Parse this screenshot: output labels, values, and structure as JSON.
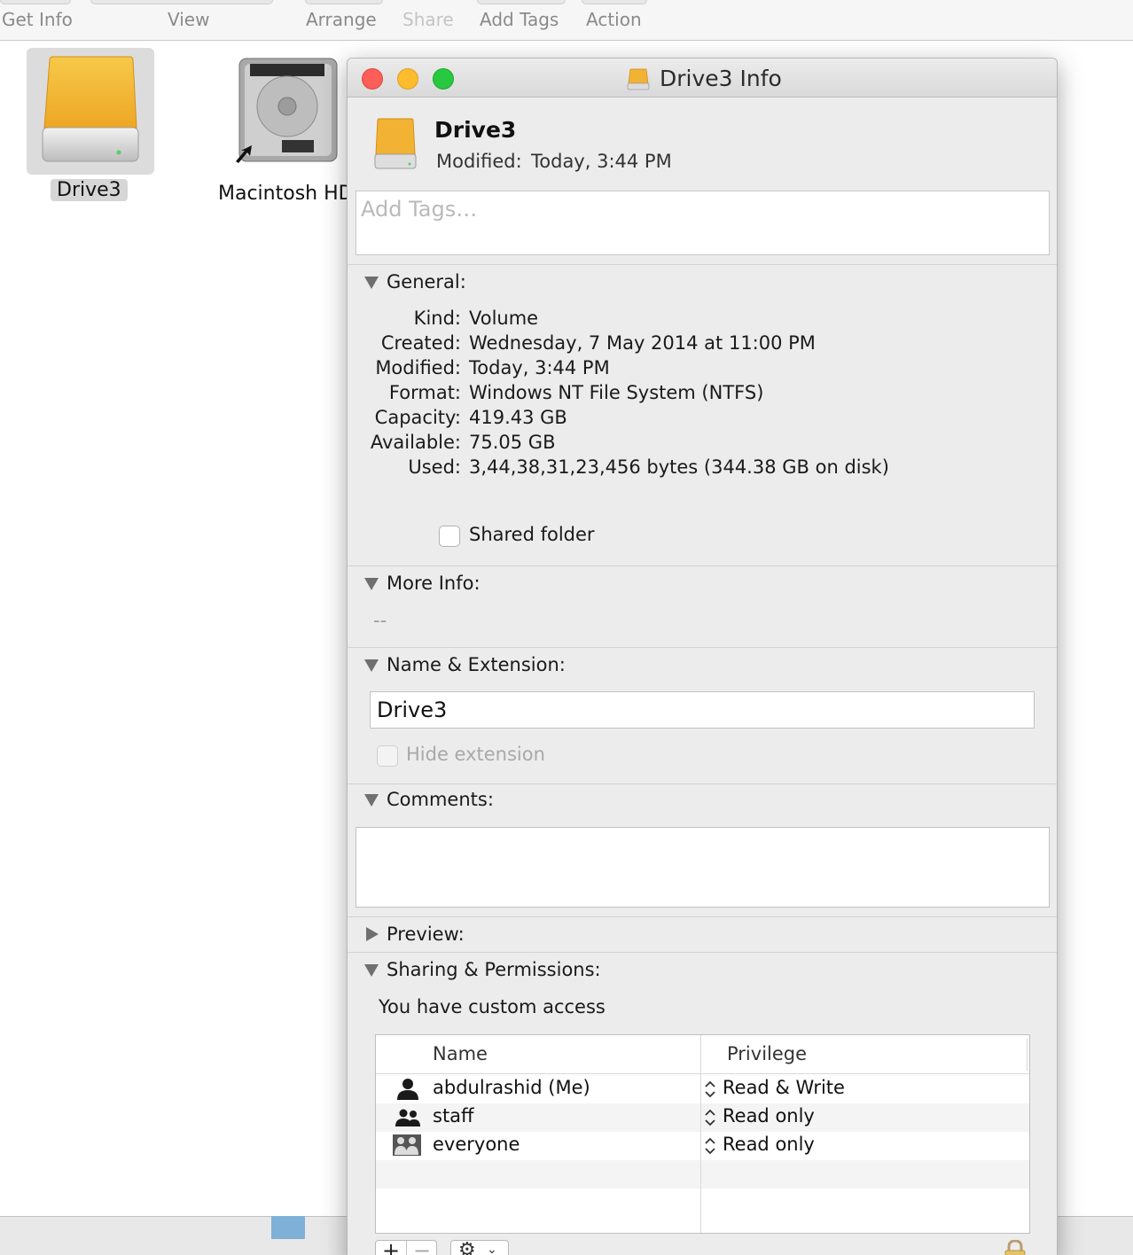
{
  "toolbar": {
    "items": [
      "Get Info",
      "View",
      "Arrange",
      "Share",
      "Add Tags",
      "Action"
    ]
  },
  "desktop": {
    "drive3_label": "Drive3",
    "macintosh_label": "Macintosh HD"
  },
  "window": {
    "title": "Drive3 Info",
    "name": "Drive3",
    "modified_label": "Modified:",
    "modified_value": "Today, 3:44 PM",
    "tags_placeholder": "Add Tags…"
  },
  "general": {
    "title": "General:",
    "rows": [
      {
        "key": "Kind:",
        "value": "Volume"
      },
      {
        "key": "Created:",
        "value": "Wednesday, 7 May 2014 at 11:00 PM"
      },
      {
        "key": "Modified:",
        "value": "Today, 3:44 PM"
      },
      {
        "key": "Format:",
        "value": "Windows NT File System (NTFS)"
      },
      {
        "key": "Capacity:",
        "value": "419.43 GB"
      },
      {
        "key": "Available:",
        "value": "75.05 GB"
      },
      {
        "key": "Used:",
        "value": "3,44,38,31,23,456 bytes (344.38 GB on disk)"
      }
    ],
    "shared_folder_label": "Shared folder"
  },
  "more_info": {
    "title": "More Info:",
    "value": "--"
  },
  "name_ext": {
    "title": "Name & Extension:",
    "value": "Drive3",
    "hide_extension_label": "Hide extension"
  },
  "comments": {
    "title": "Comments:"
  },
  "preview": {
    "title": "Preview:"
  },
  "sharing": {
    "title": "Sharing & Permissions:",
    "access_text": "You have custom access",
    "col_name": "Name",
    "col_privilege": "Privilege",
    "rows": [
      {
        "name": "abdulrashid (Me)",
        "privilege": "Read & Write",
        "icon": "user-icon"
      },
      {
        "name": "staff",
        "privilege": "Read only",
        "icon": "group-icon"
      },
      {
        "name": "everyone",
        "privilege": "Read only",
        "icon": "everyone-icon"
      }
    ]
  },
  "colors": {
    "close": "#fc5f57",
    "minimize": "#fdbc2e",
    "maximize": "#28c840",
    "drive_orange": "#f2b233"
  }
}
